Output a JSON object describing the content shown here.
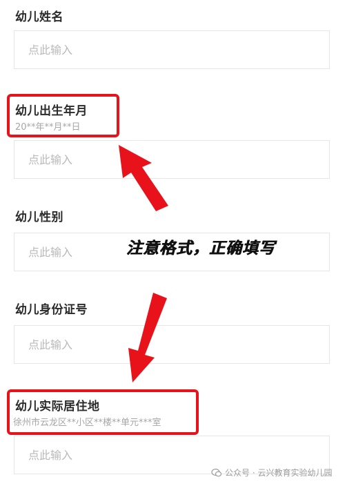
{
  "fields": [
    {
      "label": "幼儿姓名",
      "placeholder": "点此输入"
    },
    {
      "label": "幼儿出生年月",
      "hint": "20**年**月**日",
      "placeholder": "点此输入"
    },
    {
      "label": "幼儿性别",
      "placeholder": "点此输入"
    },
    {
      "label": "幼儿身份证号",
      "placeholder": "点此输入"
    },
    {
      "label": "幼儿实际居住地",
      "hint": "徐州市云龙区**小区**楼**单元***室",
      "placeholder": "点此输入"
    }
  ],
  "annotation": "注意格式，正确填写",
  "watermark": "公众号 · 云兴教育实验幼儿园",
  "colors": {
    "highlight": "#e8131a",
    "placeholder": "#b9b9b9",
    "border": "#e6e6e6"
  }
}
